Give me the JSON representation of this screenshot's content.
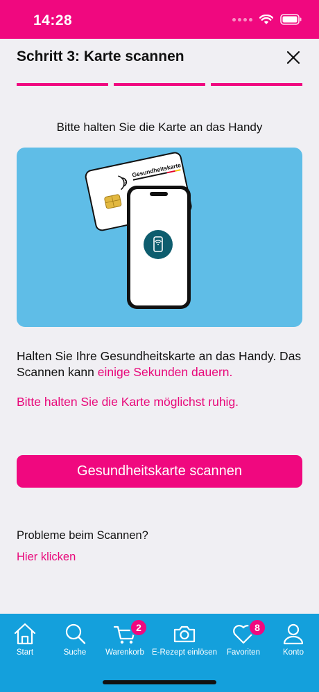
{
  "status_bar": {
    "time": "14:28"
  },
  "header": {
    "title": "Schritt 3: Karte scannen",
    "close_icon": "close-icon",
    "progress_steps": 3,
    "progress_current": 3
  },
  "instruction": "Bitte halten Sie die Karte an das Handy",
  "illustration": {
    "card_label": "Gesundheitskarte"
  },
  "info": {
    "text_main": "Halten Sie Ihre Gesundheitskarte an das Handy. Das Scannen kann ",
    "text_highlight": "einige Sekunden dauern.",
    "hint": "Bitte halten Sie die Karte möglichst ruhig."
  },
  "scan_button": "Gesundheitskarte scannen",
  "problem": {
    "text": "Probleme beim Scannen?",
    "link": "Hier klicken"
  },
  "tabbar": {
    "tabs": [
      {
        "label": "Start",
        "icon": "home-icon"
      },
      {
        "label": "Suche",
        "icon": "search-icon"
      },
      {
        "label": "Warenkorb",
        "icon": "cart-icon",
        "badge": "2"
      },
      {
        "label": "E-Rezept einlösen",
        "icon": "camera-icon"
      },
      {
        "label": "Favoriten",
        "icon": "heart-icon",
        "badge": "8"
      },
      {
        "label": "Konto",
        "icon": "user-icon"
      }
    ]
  },
  "colors": {
    "brand_pink": "#f0087f",
    "tab_blue": "#14a0dc",
    "illustration_bg": "#5fbde7",
    "background": "#f0eff3"
  }
}
